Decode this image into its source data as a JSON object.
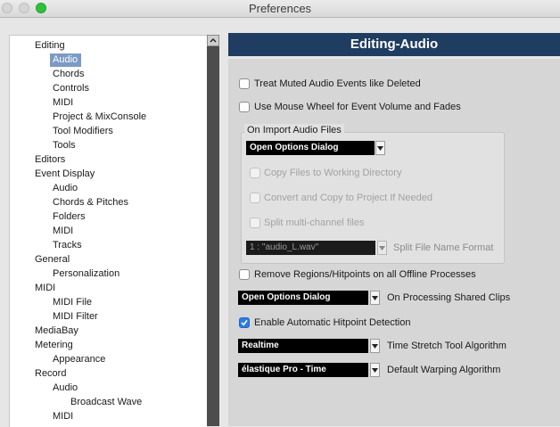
{
  "window": {
    "title": "Preferences"
  },
  "tree": {
    "items": [
      {
        "label": "Editing",
        "level": 0
      },
      {
        "label": "Audio",
        "level": 1,
        "selected": true
      },
      {
        "label": "Chords",
        "level": 1
      },
      {
        "label": "Controls",
        "level": 1
      },
      {
        "label": "MIDI",
        "level": 1
      },
      {
        "label": "Project & MixConsole",
        "level": 1
      },
      {
        "label": "Tool Modifiers",
        "level": 1
      },
      {
        "label": "Tools",
        "level": 1
      },
      {
        "label": "Editors",
        "level": 0
      },
      {
        "label": "Event Display",
        "level": 0
      },
      {
        "label": "Audio",
        "level": 1
      },
      {
        "label": "Chords & Pitches",
        "level": 1
      },
      {
        "label": "Folders",
        "level": 1
      },
      {
        "label": "MIDI",
        "level": 1
      },
      {
        "label": "Tracks",
        "level": 1
      },
      {
        "label": "General",
        "level": 0
      },
      {
        "label": "Personalization",
        "level": 1
      },
      {
        "label": "MIDI",
        "level": 0
      },
      {
        "label": "MIDI File",
        "level": 1
      },
      {
        "label": "MIDI Filter",
        "level": 1
      },
      {
        "label": "MediaBay",
        "level": 0
      },
      {
        "label": "Metering",
        "level": 0
      },
      {
        "label": "Appearance",
        "level": 1
      },
      {
        "label": "Record",
        "level": 0
      },
      {
        "label": "Audio",
        "level": 1
      },
      {
        "label": "Broadcast Wave",
        "level": 2
      },
      {
        "label": "MIDI",
        "level": 1
      }
    ]
  },
  "panel": {
    "header": "Editing-Audio",
    "treat_muted": {
      "label": "Treat Muted Audio Events like Deleted",
      "checked": false
    },
    "mouse_wheel": {
      "label": "Use Mouse Wheel for Event Volume and Fades",
      "checked": false
    },
    "import_group": {
      "title": "On Import Audio Files",
      "dropdown": "Open Options Dialog",
      "copy_files": {
        "label": "Copy Files to Working Directory",
        "checked": false
      },
      "convert_copy": {
        "label": "Convert and Copy to Project If Needed",
        "checked": false
      },
      "split_multi": {
        "label": "Split multi-channel files",
        "checked": false
      },
      "split_format_value": "1 : \"audio_L.wav\"",
      "split_format_label": "Split File Name Format"
    },
    "remove_regions": {
      "label": "Remove Regions/Hitpoints on all Offline Processes",
      "checked": false
    },
    "shared_clips": {
      "value": "Open Options Dialog",
      "label": "On Processing Shared Clips"
    },
    "hitpoint": {
      "label": "Enable Automatic Hitpoint Detection",
      "checked": true
    },
    "time_stretch": {
      "value": "Realtime",
      "label": "Time Stretch Tool Algorithm"
    },
    "warping": {
      "value": "élastique Pro - Time",
      "label": "Default Warping Algorithm"
    }
  },
  "colors": {
    "header_bg": "#1f3d61",
    "selection": "#7b9bc4",
    "checkbox_checked": "#2d7be5",
    "zoom_button": "#2ec23a"
  }
}
